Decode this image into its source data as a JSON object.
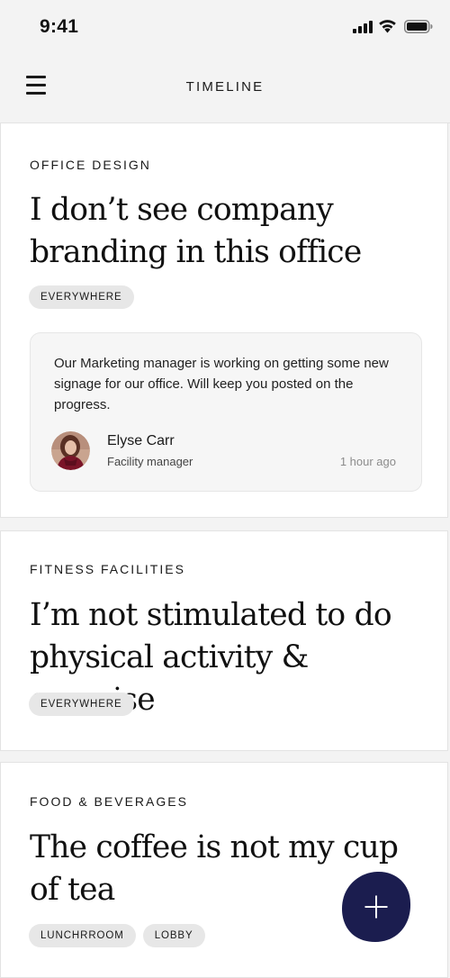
{
  "status_bar": {
    "time": "9:41"
  },
  "header": {
    "title": "TIMELINE"
  },
  "feed": {
    "cards": [
      {
        "category": "OFFICE DESIGN",
        "title_lines": [
          "I don’t see company",
          "branding in this office"
        ],
        "tags": [
          "EVERYWHERE"
        ],
        "reply": {
          "text": "Our Marketing manager is working on getting some new signage for our office. Will keep you posted on the progress.",
          "author_name": "Elyse Carr",
          "author_role": "Facility manager",
          "time": "1 hour ago"
        }
      },
      {
        "category": "FITNESS FACILITIES",
        "title_lines": [
          "I’m not stimulated to do",
          "physical activity & exercise"
        ],
        "tags": [
          "EVERYWHERE"
        ]
      },
      {
        "category": "FOOD & BEVERAGES",
        "title_lines": [
          "The coffee is not my cup",
          "of tea"
        ],
        "tags": [
          "LUNCHRROOM",
          "LOBBY"
        ]
      }
    ]
  },
  "fab": {
    "icon": "plus-icon",
    "color": "#1b1d4f"
  },
  "colors": {
    "background": "#f3f3f3",
    "card": "#ffffff",
    "tag": "#e7e7e7",
    "accent": "#1b1d4f"
  }
}
